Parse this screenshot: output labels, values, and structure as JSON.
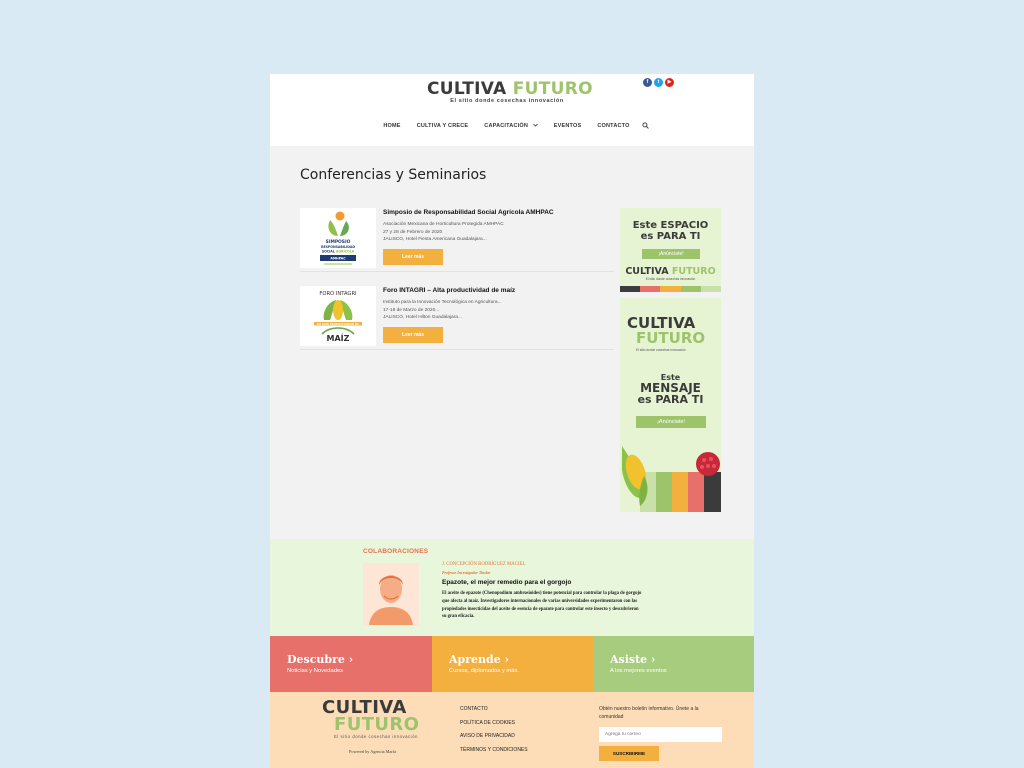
{
  "header": {
    "logo_word1": "CULTIVA",
    "logo_word2": "FUTURO",
    "logo_tagline": "El sitio donde cosechas innovación",
    "social": [
      {
        "icon": "facebook-icon",
        "color": "#3b5998",
        "glyph": "f"
      },
      {
        "icon": "twitter-icon",
        "color": "#1da1f2",
        "glyph": "t"
      },
      {
        "icon": "youtube-icon",
        "color": "#e62117",
        "glyph": "▶"
      }
    ]
  },
  "nav": {
    "items": [
      "HOME",
      "CULTIVA Y CRECE",
      "CAPACITACIÓN",
      "EVENTOS",
      "CONTACTO"
    ],
    "dropdown_icon": "chevron-down-icon",
    "search_icon": "search-icon"
  },
  "main": {
    "title": "Conferencias y Seminarios",
    "posts": [
      {
        "title": "Simposio de Responsabilidad Social Agrícola AMHPAC",
        "org": "Asociación Mexicana de Horticultura Protegida AMHPAC",
        "date": "27 y 28 de Febrero de 2020",
        "place": "JALISCO, Hotel Fiesta Americana Guadalajara...",
        "button": "Leer más",
        "thumb_lines": [
          "SIMPOSIO",
          "RESPONSABILIDAD",
          "SOCIAL AGRÍCOLA",
          "AMHPAC"
        ]
      },
      {
        "title": "Foro INTAGRI – Alta productividad de maíz",
        "org": "Instituto para la Innovación Tecnológica en Agricultura...",
        "date": "17-18 de Marzo de 2020...",
        "place": "JALISCO, Hotel Hilton Guadalajara...",
        "button": "Leer más",
        "thumb_lines": [
          "FORO INTAGRI",
          "DE ALTA PRODUCTIVIDAD DE",
          "MAÍZ"
        ]
      }
    ]
  },
  "ads": {
    "ad1": {
      "line1": "Este",
      "line2": "ESPACIO",
      "line3": "es PARA TI",
      "cta": "¡Anúnciate!",
      "logo1": "CULTIVA",
      "logo2": "FUTURO",
      "tagline": "El sitio donde cosechas innovación"
    },
    "ad2": {
      "logo1": "CULTIVA",
      "logo2": "FUTURO",
      "tagline": "El sitio donde cosechas innovación",
      "line1": "Este",
      "line2": "MENSAJE",
      "line3": "es PARA TI",
      "cta": "¡Anúnciate!"
    },
    "bar_colors": [
      "#3b3b3b",
      "#e8706a",
      "#f4b03e",
      "#9ec46b",
      "#c9e0a8"
    ]
  },
  "colab": {
    "label": "COLABORACIONES",
    "author": "J. CONCEPCIÓN RODRÍGUEZ MACIEL",
    "role": "Profesor Investigador Titular",
    "title": "Epazote, el mejor remedio para el gorgojo",
    "body": "El aceite de epazote (Chenopodium ambrosioides) tiene potencial para controlar la plaga de gorgojo que afecta al maíz. Investigadores internacionales de varias universidades experimentaron con las propiedades insecticidas del aceite de esencia de epazote para controlar este insecto y descubrieron su gran eficacia."
  },
  "cta": [
    {
      "title": "Descubre",
      "sub": "Noticias y Novedades",
      "color": "#e8706a"
    },
    {
      "title": "Aprende",
      "sub": "Cursos, diplomados y más.",
      "color": "#f4b03e"
    },
    {
      "title": "Asiste",
      "sub": "A los mejores eventos",
      "color": "#a8cc7e"
    }
  ],
  "footer": {
    "logo1": "CULTIVA",
    "logo2": "FUTURO",
    "tagline": "El sitio donde cosechas innovación",
    "powered": "Powered by Agencia Marfa",
    "links": [
      "CONTACTO",
      "POLÍTICA DE COOKIES",
      "AVISO DE PRIVACIDAD",
      "TÉRMINOS Y CONDICIONES"
    ],
    "newsletter_text": "Obtén nuestro boletín informativo. Únete a la comunidad",
    "email_placeholder": "Agrega tu correo",
    "subscribe": "SUSCRIBIRME"
  }
}
